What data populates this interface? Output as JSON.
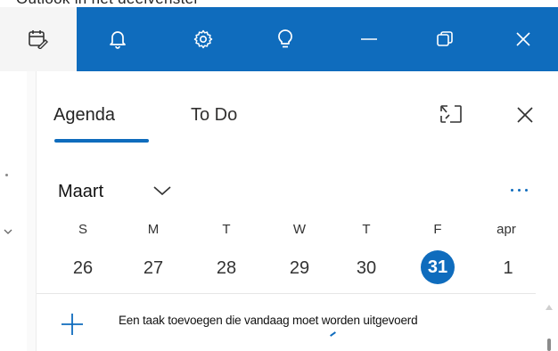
{
  "top_fragment": "Outlook in het deelvenster ",
  "titlebar": {
    "buttons": [
      {
        "name": "my-day-icon"
      },
      {
        "name": "bell-icon"
      },
      {
        "name": "gear-icon"
      },
      {
        "name": "lightbulb-icon"
      },
      {
        "name": "minimize-icon"
      },
      {
        "name": "restore-icon"
      },
      {
        "name": "close-icon"
      }
    ],
    "accent": "#0f6cbd"
  },
  "panel": {
    "tabs": [
      {
        "label": "Agenda",
        "selected": true
      },
      {
        "label": "To Do",
        "selected": false
      }
    ]
  },
  "calendar": {
    "month": "Maart",
    "weekdays": [
      "S",
      "M",
      "T",
      "W",
      "T",
      "F",
      "apr"
    ],
    "days": [
      "26",
      "27",
      "28",
      "29",
      "30",
      "31",
      "1"
    ],
    "today": "31"
  },
  "add_task": {
    "label": "Een taak toevoegen die vandaag moet worden uitgevoerd"
  }
}
